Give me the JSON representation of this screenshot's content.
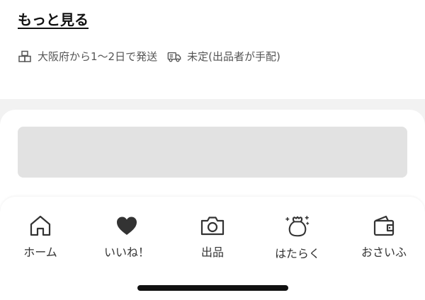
{
  "header": {
    "more_link": "もっと見る"
  },
  "shipping": {
    "origin_icon": "box-icon",
    "origin_text": "大阪府から1〜2日で発送",
    "method_icon": "truck-icon",
    "method_text": "未定(出品者が手配)"
  },
  "tabbar": {
    "items": [
      {
        "label": "ホーム",
        "icon": "home-icon"
      },
      {
        "label": "いいね！",
        "icon": "heart-icon"
      },
      {
        "label": "出品",
        "icon": "camera-icon"
      },
      {
        "label": "はたらく",
        "icon": "money-bag-icon"
      },
      {
        "label": "おさいふ",
        "icon": "wallet-icon"
      }
    ]
  },
  "colors": {
    "background": "#f2f2f2",
    "surface": "#ffffff",
    "placeholder": "#e2e2e2",
    "text_primary": "#111111",
    "text_secondary": "#555555"
  }
}
